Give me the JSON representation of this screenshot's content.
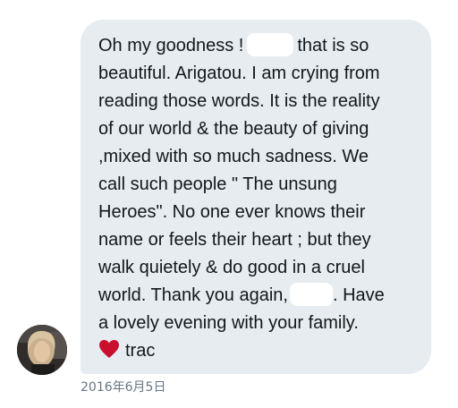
{
  "message": {
    "lines": [
      {
        "before": "Oh my goodness !",
        "after": "that is so"
      },
      {
        "text": "beautiful. Arigatou. I am crying from"
      },
      {
        "text": "reading those words. It is the reality"
      },
      {
        "text": "of our world & the beauty of giving"
      },
      {
        "text": ",mixed with so much sadness. We"
      },
      {
        "text": "call such people \" The unsung"
      },
      {
        "text": "Heroes\". No one ever knows their"
      },
      {
        "text": "name or feels their heart ; but they"
      },
      {
        "text": "walk quietely & do good in a cruel"
      },
      {
        "before": "world. Thank you again,",
        "after": ". Have"
      },
      {
        "text": "a lovely evening with your family."
      }
    ],
    "signature": "trac",
    "heart_icon": "heart-icon",
    "heart_color": "#c8102e",
    "bubble_color": "#e6ecf0"
  },
  "timestamp": "2016年6月5日",
  "avatar": {
    "icon": "user-avatar"
  }
}
